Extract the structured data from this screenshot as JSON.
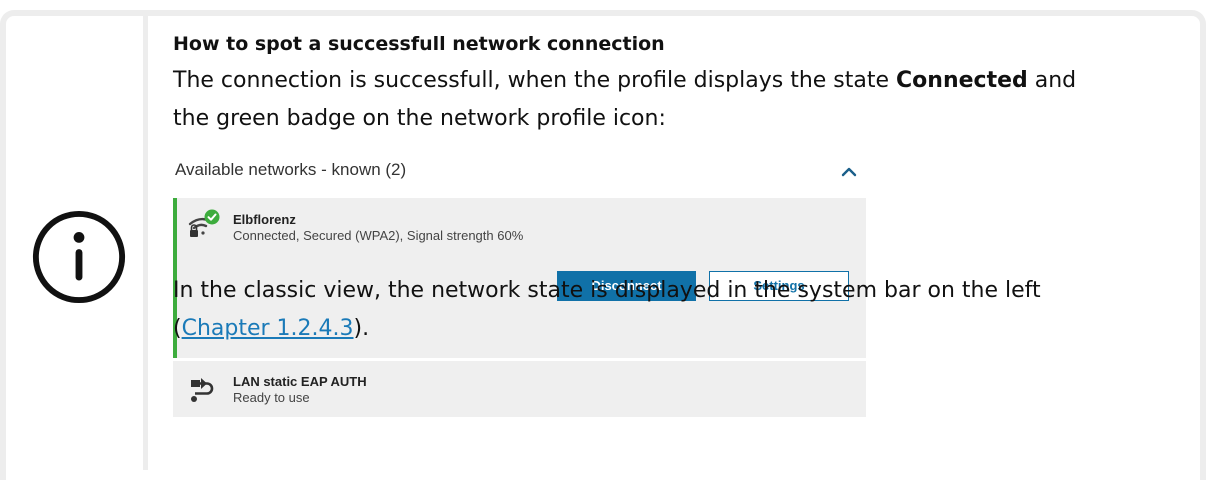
{
  "note": {
    "title": "How to spot a successfull network connection",
    "para1": {
      "line1_before": "The connection is successfull, when the profile displays the state ",
      "line1_bold": "Connected",
      "line1_after": " and",
      "line2": "the green badge on the network profile icon:"
    },
    "para2": {
      "line1": "In the classic view, the network state is displayed in the system bar on the left",
      "open_paren": "(",
      "link": "Chapter 1.2.4.3",
      "close": ")."
    }
  },
  "screenshot": {
    "section_title": "Available networks - known (2)",
    "networks": [
      {
        "name": "Elbflorenz",
        "status": "Connected, Secured (WPA2), Signal strength 60%",
        "icon": "wifi-lock-icon",
        "badge": "check-badge-icon",
        "accent": "#3dac3d"
      },
      {
        "name": "LAN static EAP AUTH",
        "status": "Ready to use",
        "icon": "lan-cable-icon"
      }
    ],
    "buttons": {
      "disconnect": "Disconnect",
      "settings": "Settings"
    },
    "colors": {
      "primary": "#1071a8",
      "card_bg": "#efefef",
      "success": "#3dac3d"
    }
  }
}
